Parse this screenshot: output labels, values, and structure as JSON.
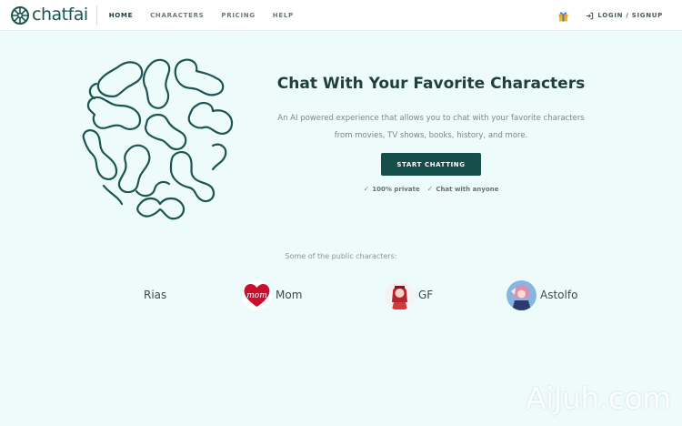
{
  "nav": {
    "brand": "chatfai",
    "menu": [
      "HOME",
      "CHARACTERS",
      "PRICING",
      "HELP"
    ],
    "active_item": "HOME",
    "login_label": "LOGIN / SIGNUP",
    "gift_icon": "gift-icon",
    "login_icon": "login-icon"
  },
  "hero": {
    "title": "Chat With Your Favorite Characters",
    "description_line1": "An AI powered experience that allows you to chat with your favorite characters",
    "description_line2": "from movies, TV shows, books, history, and more.",
    "cta_label": "START CHATTING",
    "features": [
      "100% private",
      "Chat with anyone"
    ]
  },
  "characters": {
    "label": "Some of the public characters:",
    "items": [
      {
        "name": "Rias"
      },
      {
        "name": "Mom",
        "avatar_text": "mom"
      },
      {
        "name": "GF"
      },
      {
        "name": "Astolfo"
      }
    ]
  },
  "colors": {
    "accent": "#154e4b",
    "background": "#eefbfb",
    "logo": "#1b5552"
  },
  "watermark": "AiJuh.com"
}
